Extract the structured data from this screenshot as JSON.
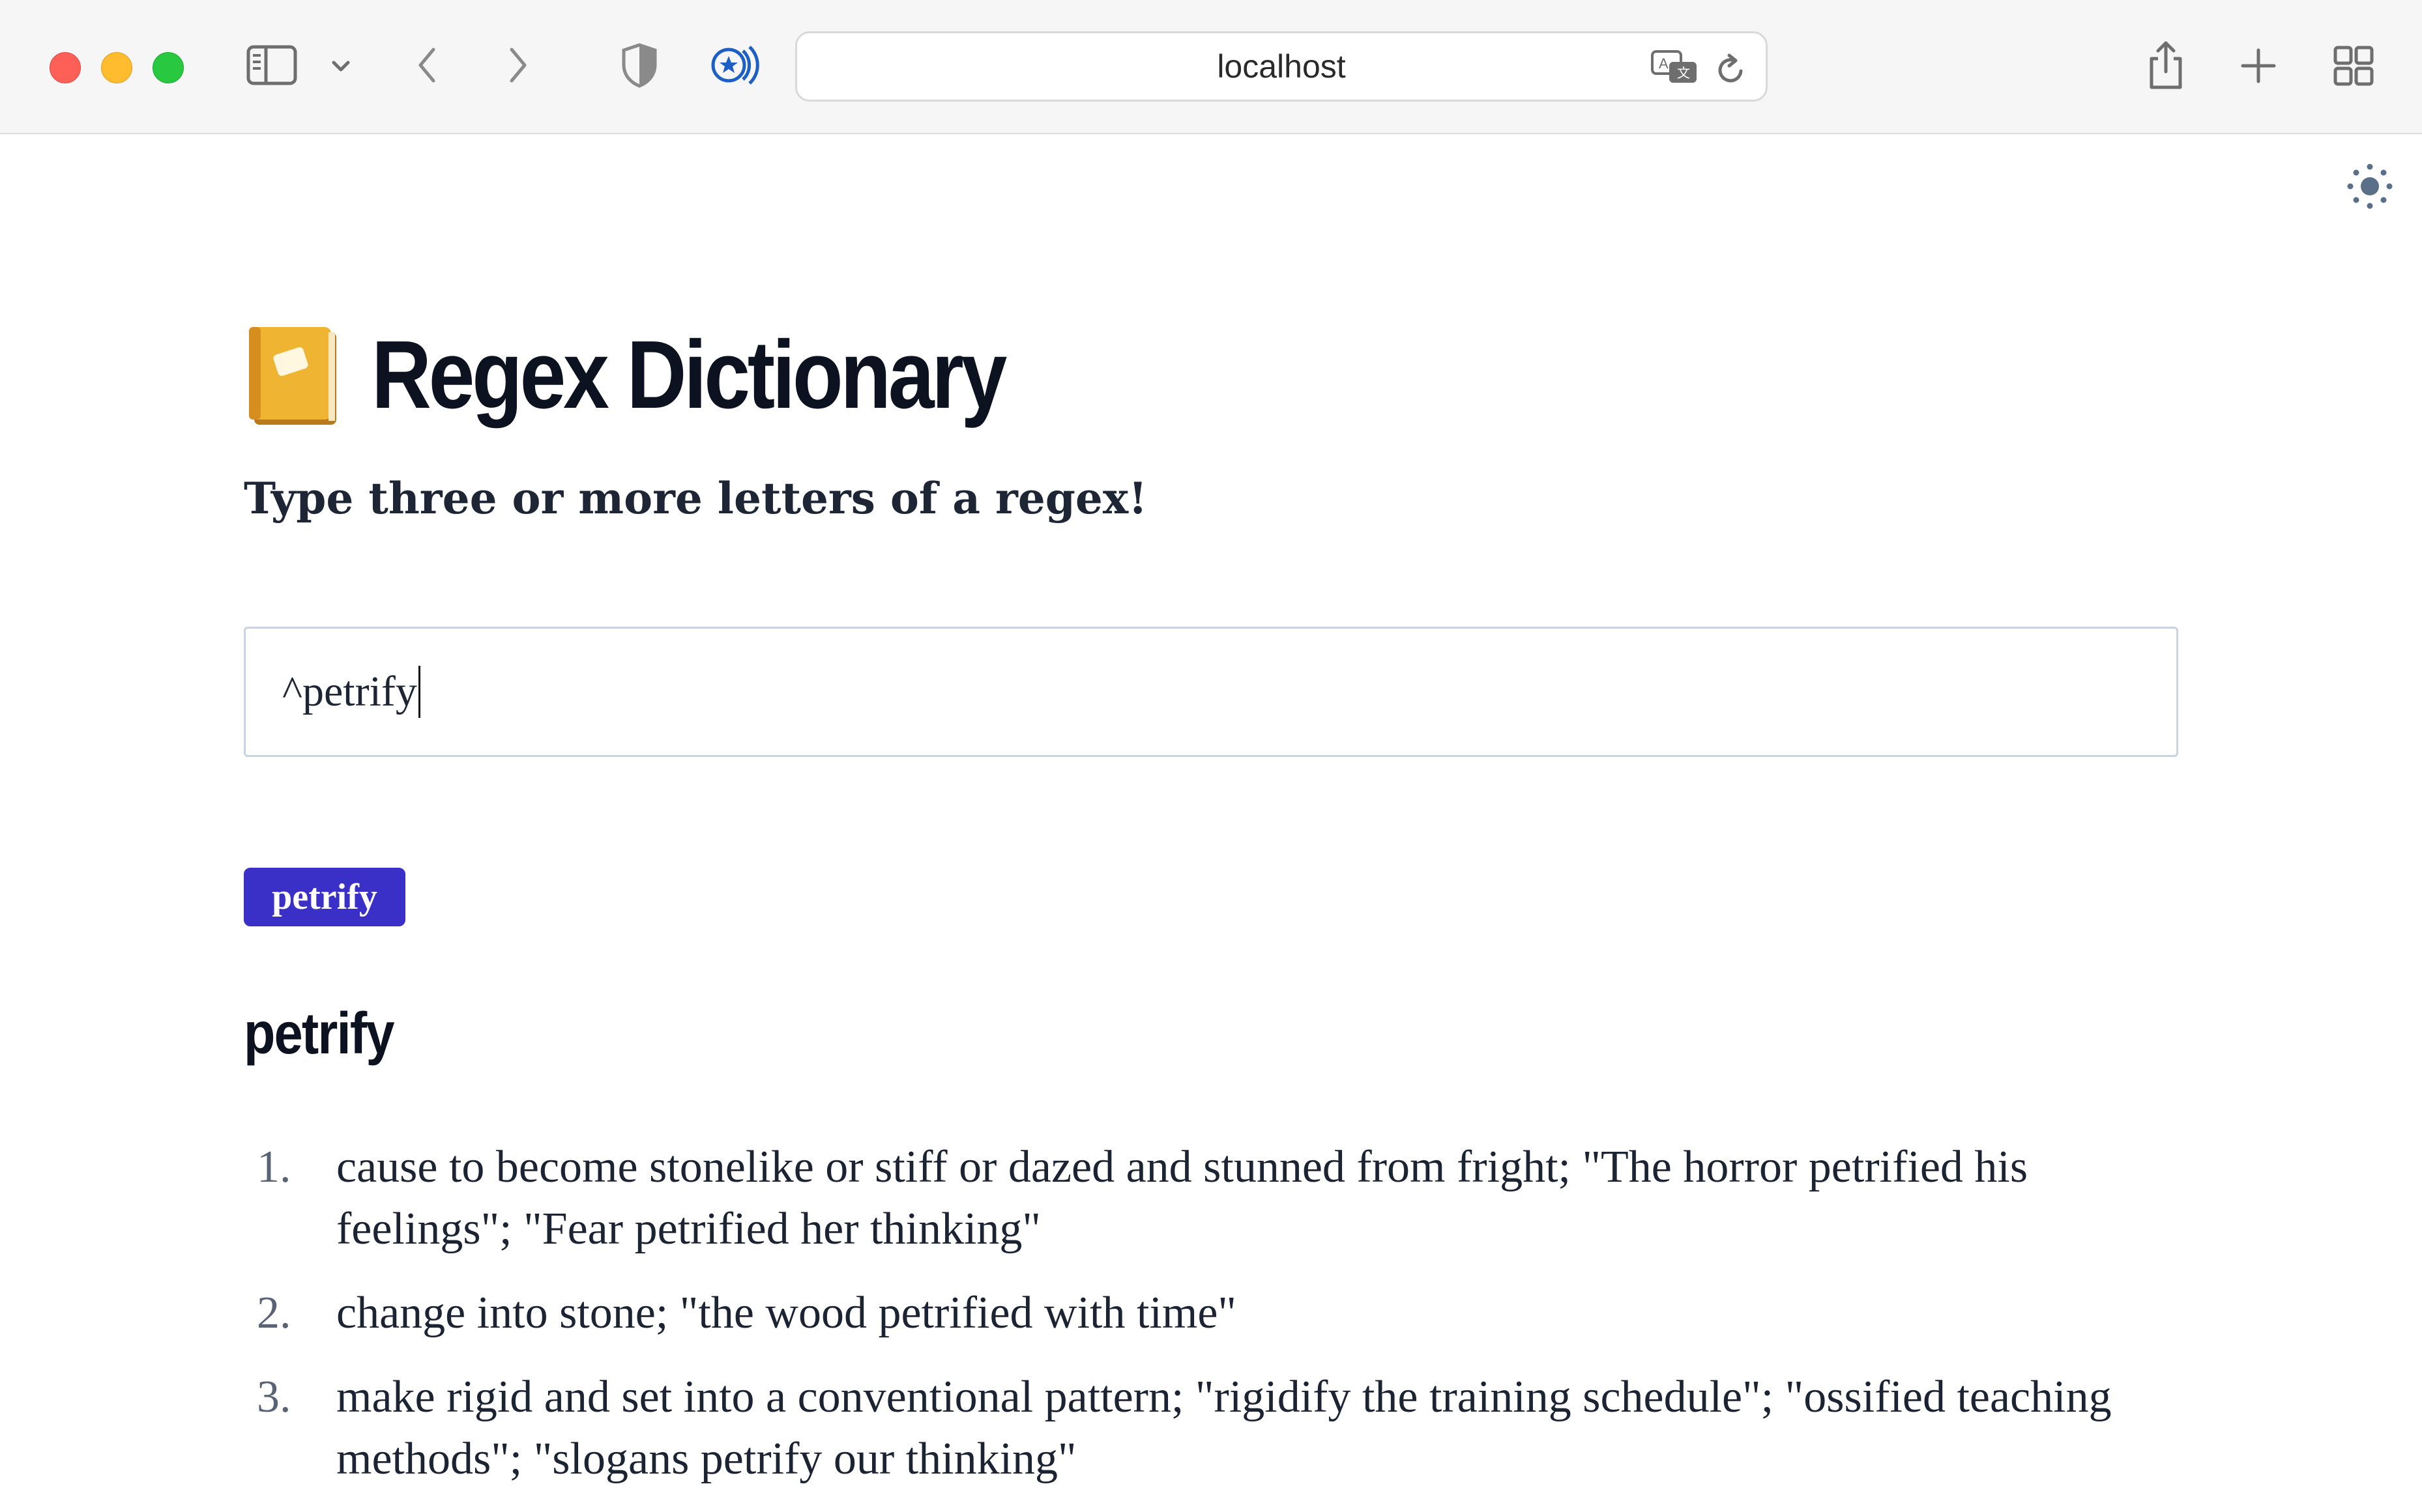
{
  "browser": {
    "url": "localhost",
    "icons": [
      "sidebar-icon",
      "chevron-down-icon",
      "back-icon",
      "forward-icon",
      "shield-icon",
      "extension-icon",
      "translate-icon",
      "reload-icon",
      "share-icon",
      "new-tab-icon",
      "tab-overview-icon"
    ]
  },
  "page": {
    "title": "Regex Dictionary",
    "subtitle": "Type three or more letters of a regex!",
    "search": {
      "value": "^petrify"
    },
    "results": [
      "petrify"
    ],
    "entry": {
      "word": "petrify",
      "definitions": [
        {
          "num": "1.",
          "text": "cause to become stonelike or stiff or dazed and stunned from fright; \"The horror petrified his feelings\"; \"Fear petrified her thinking\""
        },
        {
          "num": "2.",
          "text": "change into stone; \"the wood petrified with time\""
        },
        {
          "num": "3.",
          "text": "make rigid and set into a conventional pattern; \"rigidify the training schedule\"; \"ossified teaching methods\"; \"slogans petrify our thinking\""
        }
      ]
    }
  },
  "colors": {
    "accent": "#3a2fc7",
    "title": "#0d1220",
    "text": "#1c2333"
  }
}
